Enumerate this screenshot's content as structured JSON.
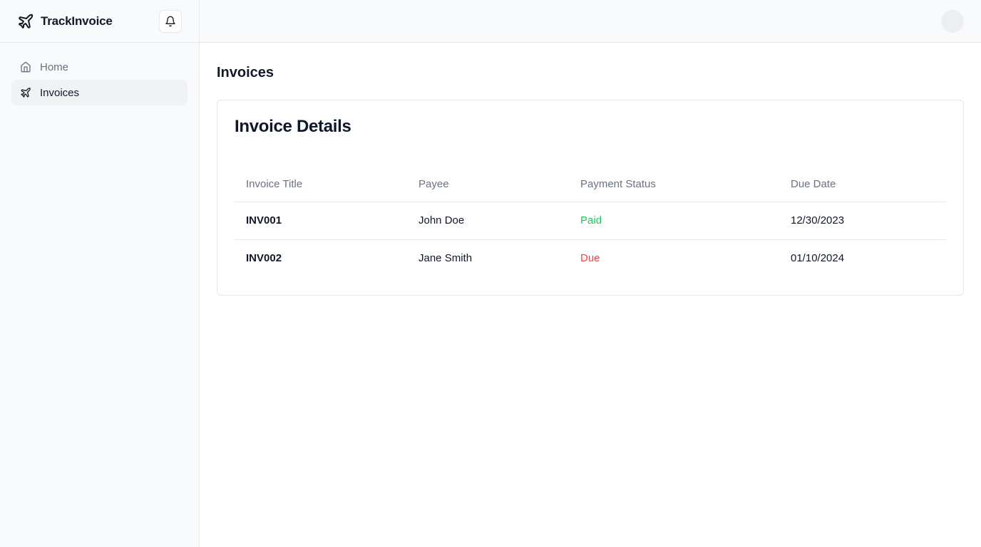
{
  "brand": {
    "name": "TrackInvoice"
  },
  "sidebar": {
    "items": [
      {
        "label": "Home",
        "icon": "home-icon",
        "active": false
      },
      {
        "label": "Invoices",
        "icon": "plane-icon",
        "active": true
      }
    ]
  },
  "page": {
    "title": "Invoices"
  },
  "card": {
    "title": "Invoice Details",
    "columns": [
      "Invoice Title",
      "Payee",
      "Payment Status",
      "Due Date"
    ],
    "rows": [
      {
        "title": "INV001",
        "payee": "John Doe",
        "status": "Paid",
        "due": "12/30/2023"
      },
      {
        "title": "INV002",
        "payee": "Jane Smith",
        "status": "Due",
        "due": "01/10/2024"
      }
    ]
  },
  "colors": {
    "paid": "#22c55e",
    "due": "#ef4444",
    "sidebar_bg": "#f9fafb",
    "active_item_bg": "#f0f2f4"
  },
  "icons": {
    "brand": "plane-icon",
    "notifications": "bell-icon",
    "avatar": "avatar"
  }
}
